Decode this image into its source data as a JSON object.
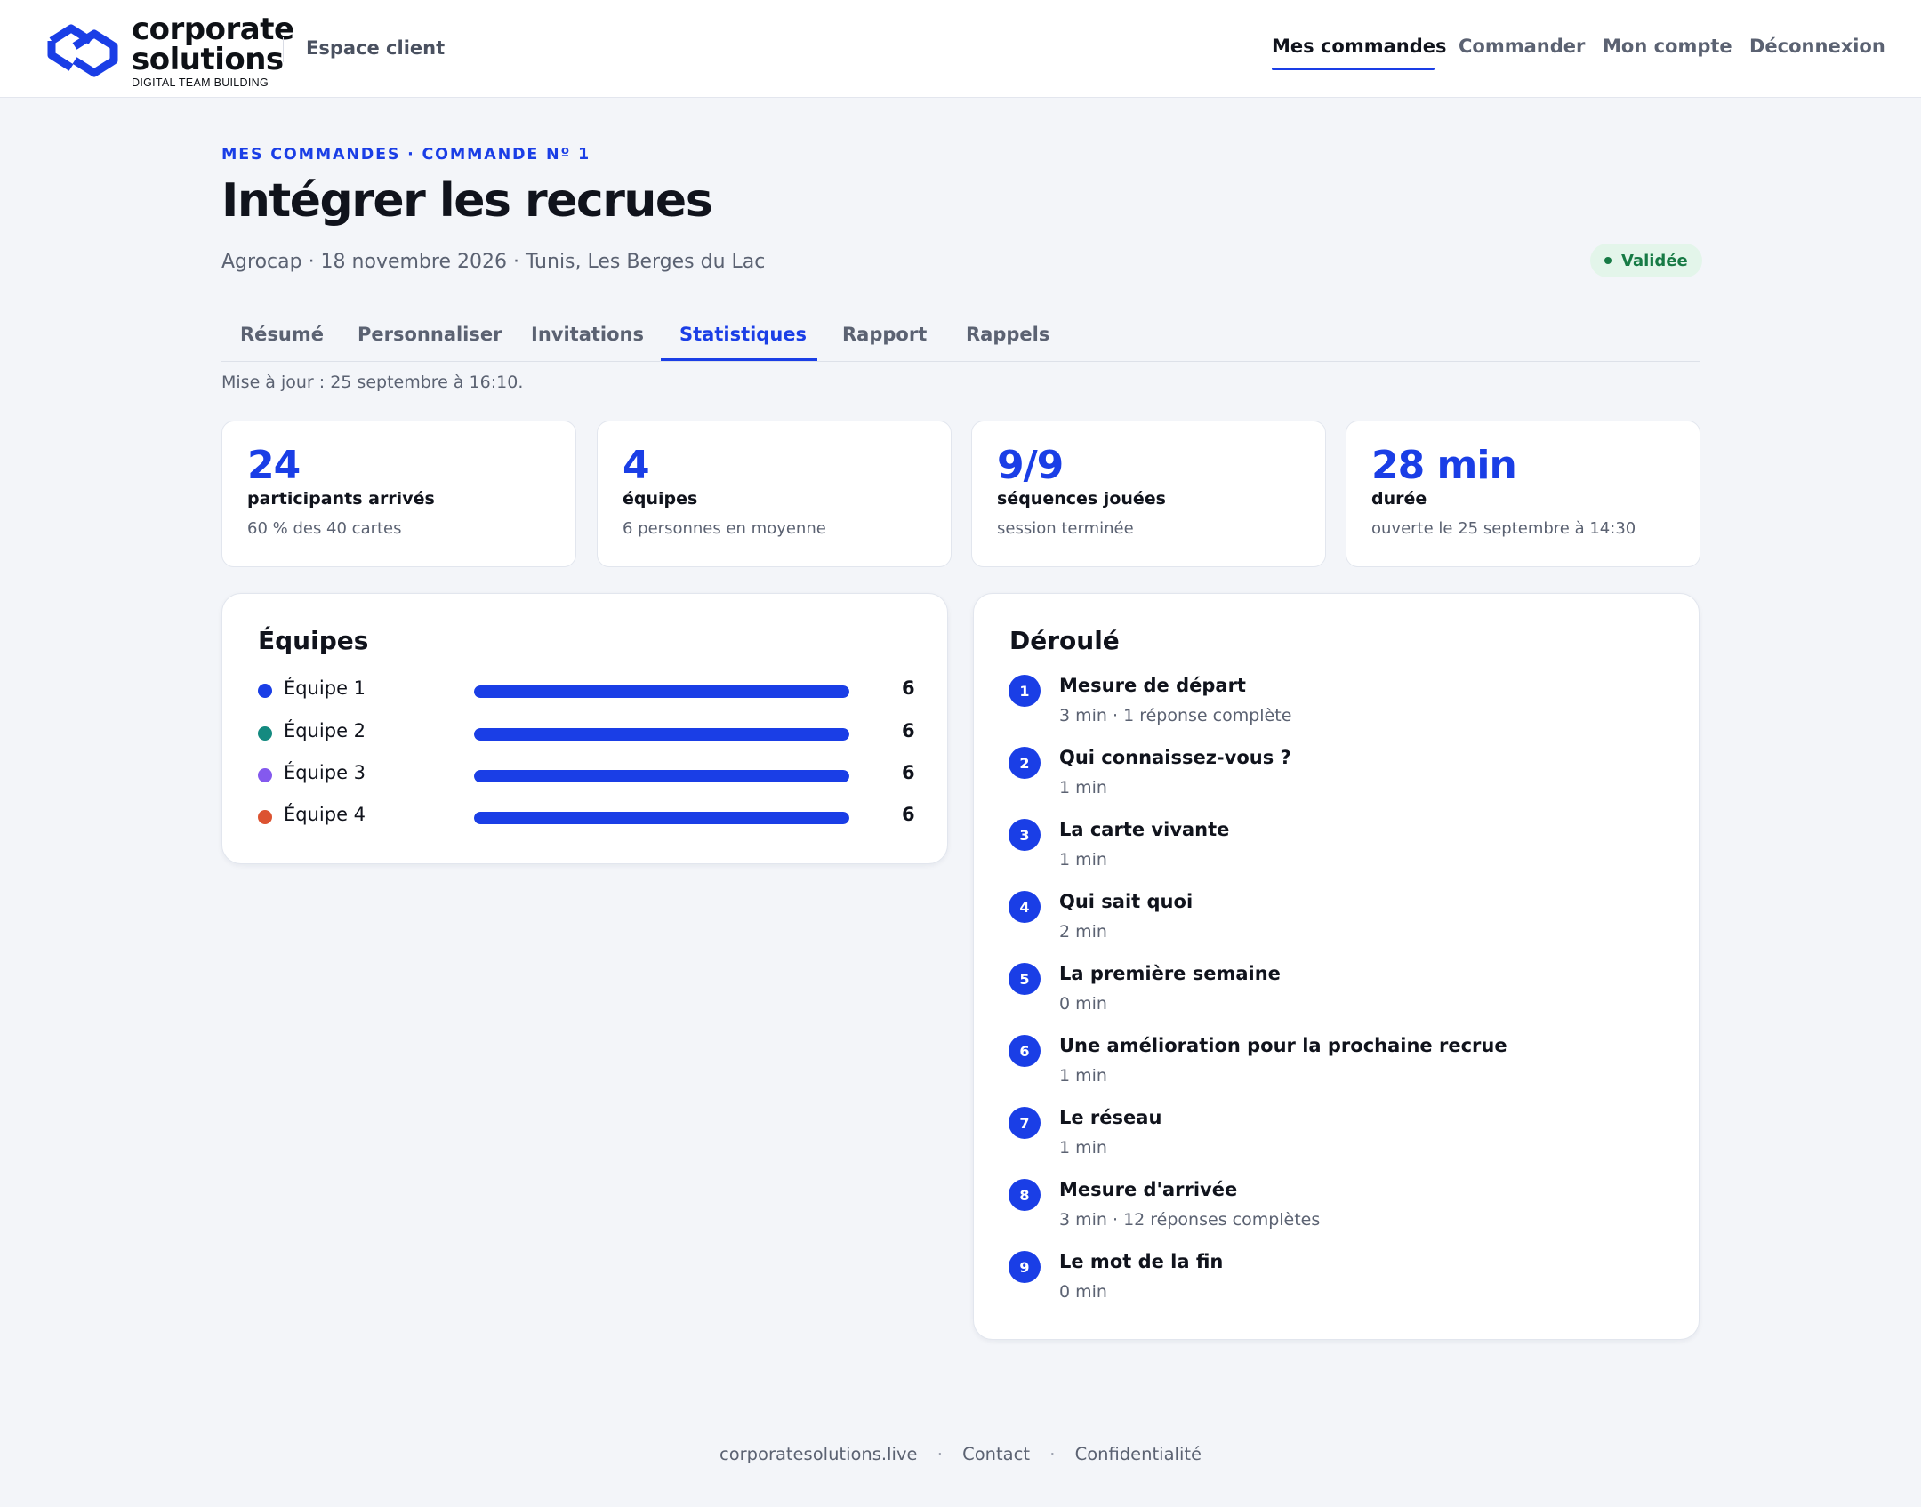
{
  "header": {
    "logo_line1": "corporate",
    "logo_line2": "solutions",
    "logo_tagline": "DIGITAL TEAM BUILDING",
    "espace": "Espace client",
    "nav": [
      "Mes commandes",
      "Commander",
      "Mon compte",
      "Déconnexion"
    ],
    "active_nav": "Mes commandes"
  },
  "page": {
    "breadcrumb": "MES COMMANDES · COMMANDE Nº 1",
    "title": "Intégrer les recrues",
    "subtitle": "Agrocap · 18 novembre 2026 · Tunis, Les Berges du Lac",
    "status": "Validée",
    "tabs": [
      "Résumé",
      "Personnaliser",
      "Invitations",
      "Statistiques",
      "Rapport",
      "Rappels"
    ],
    "active_tab": "Statistiques",
    "updated": "Mise à jour : 25 septembre à 16:10."
  },
  "stats": [
    {
      "value": "24",
      "label": "participants arrivés",
      "sub": "60 % des 40 cartes"
    },
    {
      "value": "4",
      "label": "équipes",
      "sub": "6 personnes en moyenne"
    },
    {
      "value": "9/9",
      "label": "séquences jouées",
      "sub": "session terminée"
    },
    {
      "value": "28 min",
      "label": "durée",
      "sub": "ouverte le 25 septembre à 14:30"
    }
  ],
  "teams": {
    "title": "Équipes",
    "items": [
      {
        "name": "Équipe 1",
        "count": "6",
        "color": "#1a3ee6",
        "fill": 1.0
      },
      {
        "name": "Équipe 2",
        "count": "6",
        "color": "#148a80",
        "fill": 1.0
      },
      {
        "name": "Équipe 3",
        "count": "6",
        "color": "#8459ee",
        "fill": 1.0
      },
      {
        "name": "Équipe 4",
        "count": "6",
        "color": "#dc5331",
        "fill": 1.0
      }
    ]
  },
  "deroule": {
    "title": "Déroulé",
    "steps": [
      {
        "num": "1",
        "title": "Mesure de départ",
        "meta": "3 min · 1 réponse complète"
      },
      {
        "num": "2",
        "title": "Qui connaissez-vous ?",
        "meta": "1 min"
      },
      {
        "num": "3",
        "title": "La carte vivante",
        "meta": "1 min"
      },
      {
        "num": "4",
        "title": "Qui sait quoi",
        "meta": "2 min"
      },
      {
        "num": "5",
        "title": "La première semaine",
        "meta": "0 min"
      },
      {
        "num": "6",
        "title": "Une amélioration pour la prochaine recrue",
        "meta": "1 min"
      },
      {
        "num": "7",
        "title": "Le réseau",
        "meta": "1 min"
      },
      {
        "num": "8",
        "title": "Mesure d'arrivée",
        "meta": "3 min · 12 réponses complètes"
      },
      {
        "num": "9",
        "title": "Le mot de la fin",
        "meta": "0 min"
      }
    ]
  },
  "footer": {
    "links": [
      "corporatesolutions.live",
      "Contact",
      "Confidentialité"
    ],
    "separator": "·"
  },
  "colors": {
    "accent": "#1a3ee6",
    "status_bg": "#e3f5ea",
    "status_fg": "#177a45",
    "page_bg": "#f3f5f9"
  }
}
